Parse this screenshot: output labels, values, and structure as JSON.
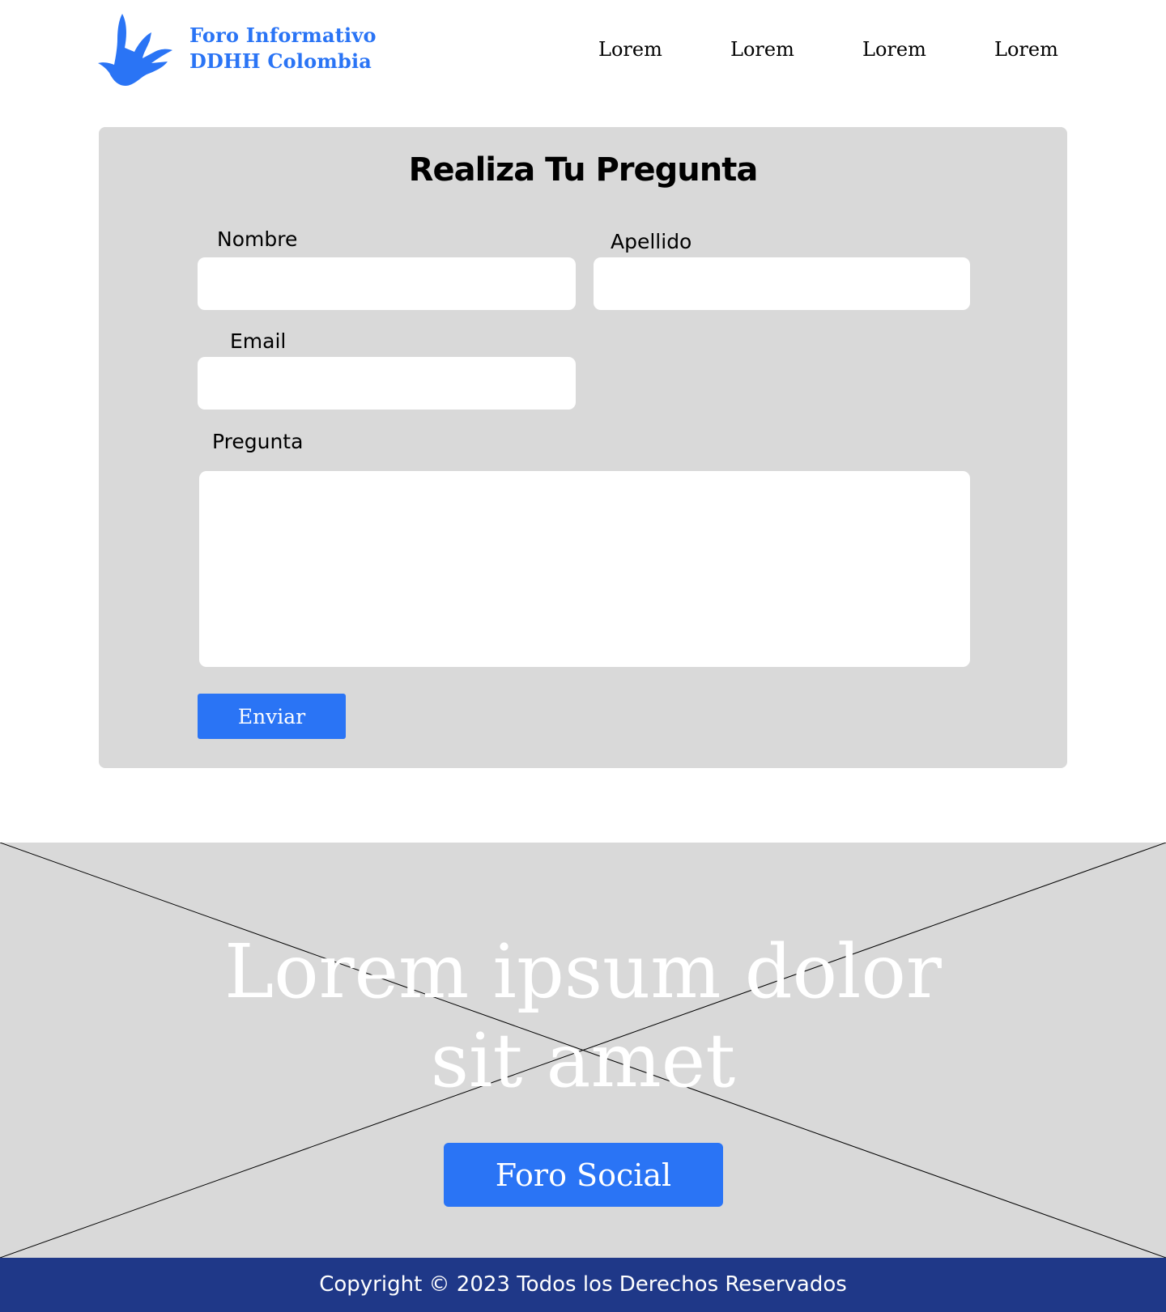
{
  "header": {
    "brand_line1": "Foro Informativo",
    "brand_line2": "DDHH Colombia",
    "logo_icon": "human-rights-hand-icon",
    "nav": [
      "Lorem",
      "Lorem",
      "Lorem",
      "Lorem"
    ]
  },
  "form": {
    "title": "Realiza Tu Pregunta",
    "nombre_label": "Nombre",
    "nombre_value": "",
    "apellido_label": "Apellido",
    "apellido_value": "",
    "email_label": "Email",
    "email_value": "",
    "pregunta_label": "Pregunta",
    "pregunta_value": "",
    "submit_label": "Enviar"
  },
  "hero": {
    "title_line1": "Lorem ipsum dolor",
    "title_line2": "sit amet",
    "button_label": "Foro Social"
  },
  "footer": {
    "copyright": "Copyright © 2023 Todos los Derechos Reservados"
  },
  "colors": {
    "accent": "#2a74f5",
    "panel": "#d9d9d9",
    "footer_bg": "#1f3888"
  }
}
